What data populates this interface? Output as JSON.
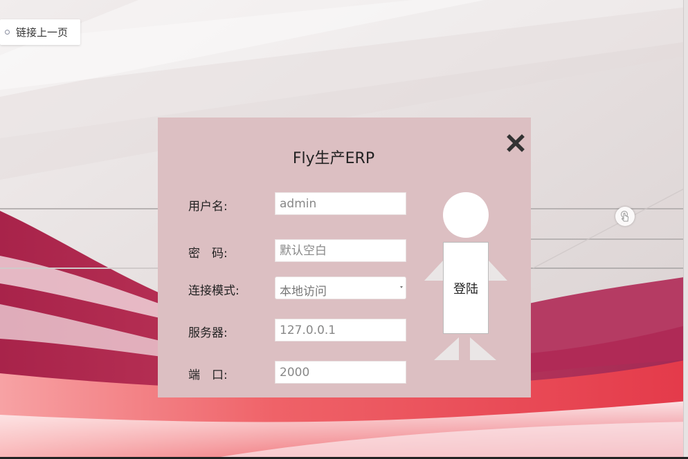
{
  "back_link": {
    "label": "链接上一页"
  },
  "dialog": {
    "title": "Fly生产ERP",
    "fields": {
      "username": {
        "label": "用户名:",
        "value": "admin"
      },
      "password": {
        "label": "密　码:",
        "placeholder": "默认空白"
      },
      "mode": {
        "label": "连接模式:",
        "selected": "本地访问"
      },
      "server": {
        "label": "服务器:",
        "value": "127.0.0.1"
      },
      "port": {
        "label": "端　口:",
        "value": "2000"
      }
    },
    "login_label": "登陆"
  },
  "icons": [
    "close-icon",
    "link-dot-icon",
    "touch-hand-icon"
  ],
  "colors": {
    "dialog_bg": "#dcbfc2",
    "accent_crimson": "#b8294f",
    "accent_red": "#e8505b"
  }
}
